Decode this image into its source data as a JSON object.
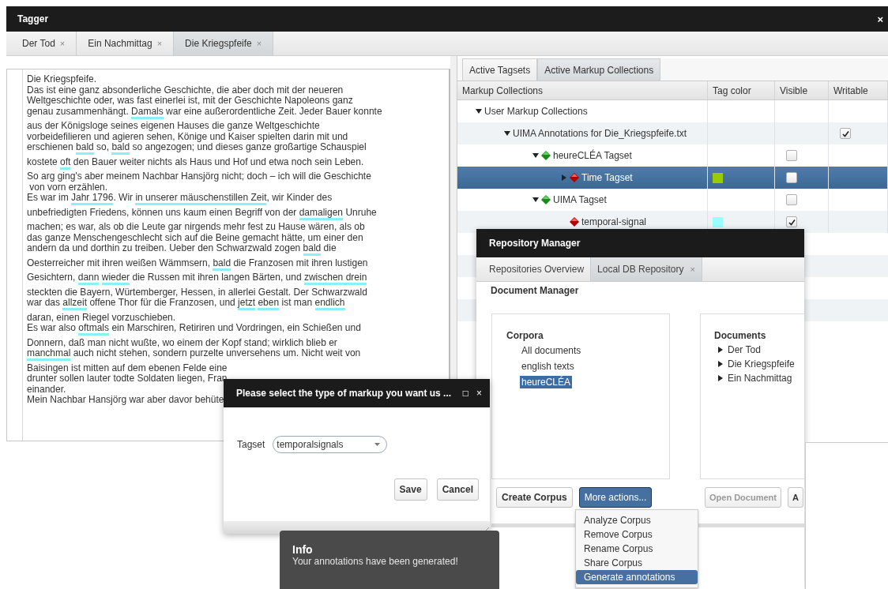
{
  "window": {
    "title": "Tagger",
    "close": "×"
  },
  "document_tabs": [
    {
      "label": "Der Tod",
      "close": "×",
      "selected": false
    },
    {
      "label": "Ein Nachmittag",
      "close": "×",
      "selected": false
    },
    {
      "label": "Die Kriegspfeife",
      "close": "×",
      "selected": true
    }
  ],
  "text": {
    "lines": [
      {
        "segments": [
          {
            "text": "Die Kriegspfeife.",
            "annotated": false
          }
        ]
      },
      {
        "segments": [
          {
            "text": "Das ist eine ganz absonderliche Geschichte, die aber doch mit der neueren",
            "annotated": false
          }
        ]
      },
      {
        "segments": [
          {
            "text": "Weltgeschichte oder, was fast einerlei ist, mit der Geschichte Napoleons ganz",
            "annotated": false
          }
        ]
      },
      {
        "segments": [
          {
            "text": "genau zusammenhängt. ",
            "annotated": false
          },
          {
            "text": "Damals",
            "annotated": true
          },
          {
            "text": " war eine außerordentliche Zeit. Jeder Bauer konnte",
            "annotated": false
          }
        ]
      },
      {
        "segments": [
          {
            "text": "aus der Königsloge seines eigenen Hauses die ganze Weltgeschichte",
            "annotated": false
          }
        ]
      },
      {
        "segments": [
          {
            "text": "vorbeidefilieren und agieren sehen, Könige und Kaiser spielten darin mit und",
            "annotated": false
          }
        ]
      },
      {
        "segments": [
          {
            "text": "erschienen ",
            "annotated": false
          },
          {
            "text": "bald",
            "annotated": true
          },
          {
            "text": " so, ",
            "annotated": false
          },
          {
            "text": "bald",
            "annotated": true
          },
          {
            "text": " so angezogen; und dieses ganze großartige Schauspiel",
            "annotated": false
          }
        ]
      },
      {
        "segments": [
          {
            "text": "kostete ",
            "annotated": false
          },
          {
            "text": "oft",
            "annotated": true
          },
          {
            "text": " den Bauer weiter nichts als Haus und Hof und etwa noch sein Leben.",
            "annotated": false
          }
        ]
      },
      {
        "segments": [
          {
            "text": "So arg ging's aber meinem Nachbar Hansjörg nicht; doch – ich will die Geschichte",
            "annotated": false
          }
        ]
      },
      {
        "segments": [
          {
            "text": " von vorn erzählen.",
            "annotated": false
          }
        ]
      },
      {
        "segments": [
          {
            "text": "Es war im ",
            "annotated": false
          },
          {
            "text": "Jahr 1796",
            "annotated": true
          },
          {
            "text": ". Wir ",
            "annotated": false
          },
          {
            "text": "in unserer mäuschenstillen Zeit",
            "annotated": true
          },
          {
            "text": ", wir Kinder des",
            "annotated": false
          }
        ]
      },
      {
        "segments": [
          {
            "text": "unbefriedigten Friedens, können uns kaum einen Begriff von der ",
            "annotated": false
          },
          {
            "text": "damaligen",
            "annotated": true
          },
          {
            "text": " Unruhe",
            "annotated": false
          }
        ]
      },
      {
        "segments": [
          {
            "text": "machen; es war, als ob die Leute gar nirgends mehr fest zu Hause wären, als ob",
            "annotated": false
          }
        ]
      },
      {
        "segments": [
          {
            "text": "das ganze Menschengeschlecht sich auf die Beine gemacht hätte, um einer den",
            "annotated": false
          }
        ]
      },
      {
        "segments": [
          {
            "text": "andern da und dorthin zu treiben. Ueber den Schwarzwald zogen ",
            "annotated": false
          },
          {
            "text": "bald",
            "annotated": true
          },
          {
            "text": " die",
            "annotated": false
          }
        ]
      },
      {
        "segments": [
          {
            "text": "Oesterreicher mit ihren weißen Wämmsern, ",
            "annotated": false
          },
          {
            "text": "bald",
            "annotated": true
          },
          {
            "text": " die Franzosen mit ihren lustigen",
            "annotated": false
          }
        ]
      },
      {
        "segments": [
          {
            "text": "Gesichtern, ",
            "annotated": false
          },
          {
            "text": "dann",
            "annotated": true
          },
          {
            "text": "wieder",
            "annotated": true
          },
          {
            "text": " die Russen mit ihren langen Bärten, und ",
            "annotated": false
          },
          {
            "text": "zwischen drein",
            "annotated": true
          }
        ]
      },
      {
        "segments": [
          {
            "text": "steckten die Bayern, Würtemberger, Hessen, in allerlei Gestalt. Der Schwarzwald",
            "annotated": false
          }
        ]
      },
      {
        "segments": [
          {
            "text": "war das ",
            "annotated": false
          },
          {
            "text": "allzeit",
            "annotated": true
          },
          {
            "text": " offene Thor für die Franzosen, und ",
            "annotated": false
          },
          {
            "text": "jetzt",
            "annotated": true
          },
          {
            "text": "eben",
            "annotated": true
          },
          {
            "text": " ist man ",
            "annotated": false
          },
          {
            "text": "endlich",
            "annotated": true
          }
        ]
      },
      {
        "segments": [
          {
            "text": "daran, einen Riegel vorzuschieben.",
            "annotated": false
          }
        ]
      },
      {
        "segments": [
          {
            "text": "Es war also ",
            "annotated": false
          },
          {
            "text": "oftmals",
            "annotated": true
          },
          {
            "text": " ein Marschiren, Retiriren und Vordringen, ein Schießen und",
            "annotated": false
          }
        ]
      },
      {
        "segments": [
          {
            "text": "Donnern, daß man nicht wußte, wo einem der Kopf stand; wirklich blieb er",
            "annotated": false
          }
        ]
      },
      {
        "segments": [
          {
            "text": "manchmal",
            "annotated": true
          },
          {
            "text": " auch nicht stehen, sondern purzelte unversehens um. Nicht weit von",
            "annotated": false
          }
        ]
      },
      {
        "segments": [
          {
            "text": "Baisingen ist mitten auf dem ebenen Felde eine",
            "annotated": false
          }
        ]
      },
      {
        "segments": [
          {
            "text": "drunter sollen lauter todte Soldaten liegen, Fran",
            "annotated": false
          }
        ]
      },
      {
        "segments": [
          {
            "text": "einander.",
            "annotated": false
          }
        ]
      },
      {
        "segments": [
          {
            "text": "Mein Nachbar Hansjörg war aber davor behüte",
            "annotated": false
          }
        ]
      }
    ]
  },
  "markup_panel": {
    "tabs": [
      {
        "label": "Active Tagsets",
        "selected": false
      },
      {
        "label": "Active Markup Collections",
        "selected": true
      }
    ],
    "columns": [
      "Markup Collections",
      "Tag color",
      "Visible",
      "Writable"
    ],
    "rows": [
      {
        "label": "User Markup Collections",
        "expanded": true,
        "selected": false,
        "children": [
          {
            "label": "UIMA Annotations for Die_Kriegspfeife.txt",
            "expanded": true,
            "selected": false,
            "writable": true,
            "children": [
              {
                "label": "heureCLÉA Tagset",
                "kind": "tagset",
                "expanded": true,
                "selected": false,
                "visible": false,
                "children": [
                  {
                    "label": "Time Tagset",
                    "kind": "tag",
                    "expanded": false,
                    "selected": true,
                    "color": "#99cc00",
                    "visible": false
                  }
                ]
              },
              {
                "label": "UIMA Tagset",
                "kind": "tagset",
                "expanded": true,
                "selected": false,
                "visible": false,
                "children": [
                  {
                    "label": "temporal-signal",
                    "kind": "tag",
                    "selected": false,
                    "color": "#99ffff",
                    "visible": true
                  }
                ]
              }
            ]
          }
        ]
      }
    ]
  },
  "repository_manager": {
    "title": "Repository Manager",
    "tabs": [
      {
        "label": "Repositories Overview",
        "selected": false
      },
      {
        "label": "Local DB Repository",
        "close": "×",
        "selected": true
      }
    ],
    "heading": "Document Manager",
    "corpora": {
      "title": "Corpora",
      "items": [
        {
          "label": "All documents",
          "selected": false
        },
        {
          "label": "english texts",
          "selected": false
        },
        {
          "label": "heureCLÉA",
          "selected": true
        }
      ]
    },
    "documents": {
      "title": "Documents",
      "items": [
        {
          "label": "Der Tod",
          "expanded": false
        },
        {
          "label": "Die Kriegspfeife",
          "expanded": false
        },
        {
          "label": "Ein Nachmittag",
          "expanded": false
        }
      ]
    },
    "corpus_buttons": [
      {
        "label": "Create Corpus",
        "pressed": false
      },
      {
        "label": "More actions...",
        "pressed": true
      }
    ],
    "document_buttons": [
      {
        "label": "Open Document",
        "disabled": true
      },
      {
        "label": "A"
      }
    ],
    "menu": [
      {
        "label": "Analyze Corpus",
        "selected": false
      },
      {
        "label": "Remove Corpus",
        "selected": false
      },
      {
        "label": "Rename Corpus",
        "selected": false
      },
      {
        "label": "Share Corpus",
        "selected": false
      },
      {
        "label": "Generate annotations",
        "selected": true
      }
    ]
  },
  "dialog": {
    "title": "Please select the type of markup you want us ...",
    "maximize": "□",
    "close": "×",
    "field_label": "Tagset",
    "value": "temporalsignals",
    "buttons": [
      "Save",
      "Cancel"
    ]
  },
  "notification": {
    "title": "Info",
    "message": "Your annotations have been generated!"
  }
}
